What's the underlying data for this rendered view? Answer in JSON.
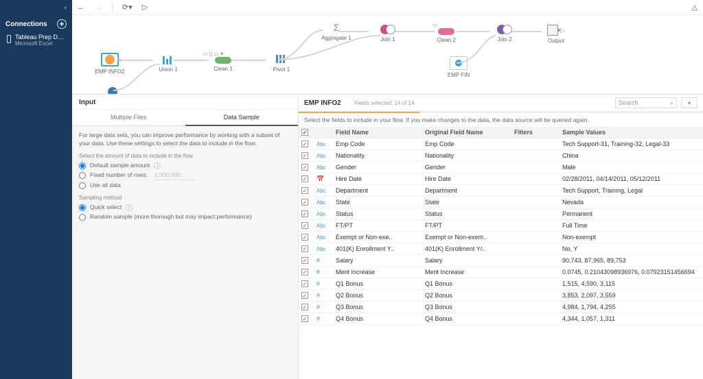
{
  "sidebar": {
    "header": "Connections",
    "item": {
      "name": "Tableau Prep Data.xlsx",
      "sub": "Microsoft Excel"
    }
  },
  "flow": {
    "nodes": {
      "emp_info2": "EMP INFO2",
      "union1": "Union 1",
      "clean1": "Clean 1",
      "pivot1": "Pivot 1",
      "aggregate1": "Aggregate 1",
      "join1": "Join 1",
      "clean2": "Clean 2",
      "join2": "Join 2",
      "output": "Output",
      "emp_fin": "EMP FIN"
    }
  },
  "lower": {
    "title": "Input",
    "tabs": {
      "multiple": "Multiple Files",
      "sample": "Data Sample"
    },
    "desc": "For large data sets, you can improve performance by working with a subset of your data. Use these settings to select the data to include in the flow.",
    "amount_header": "Select the amount of data to include in the flow",
    "opt_default": "Default sample amount",
    "opt_fixed": "Fixed number of rows:",
    "opt_fixed_val": "1,000,000",
    "opt_all": "Use all data",
    "method_header": "Sampling method",
    "opt_quick": "Quick select",
    "opt_random": "Random sample (more thorough but may impact performance)"
  },
  "grid": {
    "title": "EMP INFO2",
    "count": "Fields selected: 14 of 14",
    "hint": "Select the fields to include in your flow. If you make changes to the data, the data source will be queried again.",
    "search_placeholder": "Search",
    "headers": {
      "field": "Field Name",
      "orig": "Original Field Name",
      "filters": "Filters",
      "sample": "Sample Values"
    },
    "rows": [
      {
        "type": "Abc",
        "field": "Emp Code",
        "orig": "Emp Code",
        "sample": "Tech Support-31, Training-32, Legal-33"
      },
      {
        "type": "Abc",
        "field": "Nationality",
        "orig": "Nationality",
        "sample": "China"
      },
      {
        "type": "Abc",
        "field": "Gender",
        "orig": "Gender",
        "sample": "Male"
      },
      {
        "type": "date",
        "field": "Hire Date",
        "orig": "Hire Date",
        "sample": "02/28/2011, 04/14/2011, 05/12/2011"
      },
      {
        "type": "Abc",
        "field": "Department",
        "orig": "Department",
        "sample": "Tech Support, Training, Legal"
      },
      {
        "type": "Abc",
        "field": "State",
        "orig": "State",
        "sample": "Nevada"
      },
      {
        "type": "Abc",
        "field": "Status",
        "orig": "Status",
        "sample": "Permanent"
      },
      {
        "type": "Abc",
        "field": "FT/PT",
        "orig": "FT/PT",
        "sample": "Full Time"
      },
      {
        "type": "Abc",
        "field": "Exempt or Non-exe..",
        "orig": "Exempt or Non-exem..",
        "sample": "Non-exempt"
      },
      {
        "type": "Abc",
        "field": "401(K) Enrollment Y..",
        "orig": "401(K) Enrollment Y/..",
        "sample": "No, Y"
      },
      {
        "type": "#",
        "field": "Salary",
        "orig": "Salary",
        "sample": "90,743, 87,965, 89,753"
      },
      {
        "type": "#",
        "field": "Merit Increase",
        "orig": "Merit Increase",
        "sample": "0.0745, 0.21043098936976, 0.07923151456694"
      },
      {
        "type": "#",
        "field": "Q1 Bonus",
        "orig": "Q1 Bonus",
        "sample": "1,515, 4,590, 3,115"
      },
      {
        "type": "#",
        "field": "Q2 Bonus",
        "orig": "Q2 Bonus",
        "sample": "3,853, 2,097, 3,559"
      },
      {
        "type": "#",
        "field": "Q3 Bonus",
        "orig": "Q3 Bonus",
        "sample": "4,984, 1,794, 4,255"
      },
      {
        "type": "#",
        "field": "Q4 Bonus",
        "orig": "Q4 Bonus",
        "sample": "4,344, 1,057, 1,311"
      }
    ]
  }
}
